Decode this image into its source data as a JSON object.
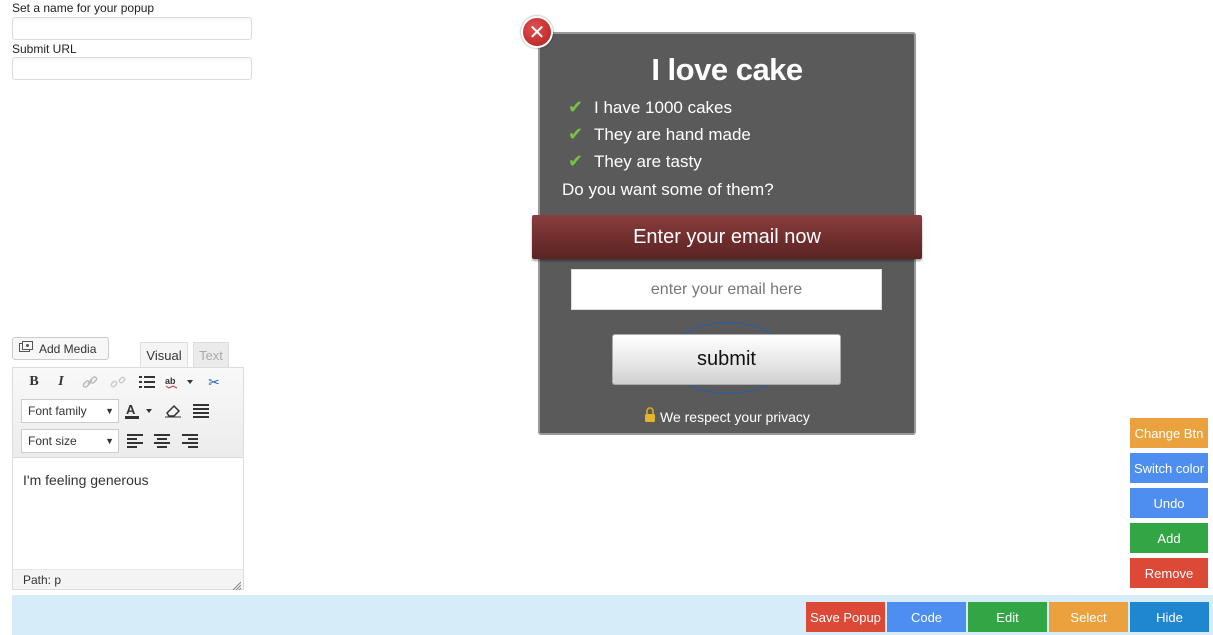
{
  "form": {
    "name_label": "Set a name for your popup",
    "name_value": "",
    "url_label": "Submit URL",
    "url_value": ""
  },
  "editor": {
    "add_media_label": "Add Media",
    "tabs": {
      "visual": "Visual",
      "text": "Text"
    },
    "font_family": "Font family",
    "font_size": "Font size",
    "content": "I'm feeling generous",
    "status_path": "Path: p"
  },
  "popup": {
    "title": "I love cake",
    "items": [
      "I have 1000 cakes",
      "They are hand made",
      "They are tasty"
    ],
    "question": "Do you want some of them?",
    "ribbon_text": "Enter your email now",
    "email_placeholder": "enter your email here",
    "submit_label": "submit",
    "privacy_text": "We respect your privacy"
  },
  "side_buttons": {
    "change_btn": "Change Btn",
    "switch_color": "Switch color",
    "undo": "Undo",
    "add": "Add",
    "remove": "Remove"
  },
  "bottom_buttons": {
    "save_popup": "Save Popup",
    "code": "Code",
    "edit": "Edit",
    "select": "Select",
    "hide": "Hide"
  },
  "colors": {
    "orange": "#eba13d",
    "blue": "#4e8ef0",
    "green": "#32a545",
    "red": "#dc4936",
    "dark_blue": "#1f86d0",
    "popup_bg": "#5a5a5a",
    "ribbon": "#7a3434"
  }
}
